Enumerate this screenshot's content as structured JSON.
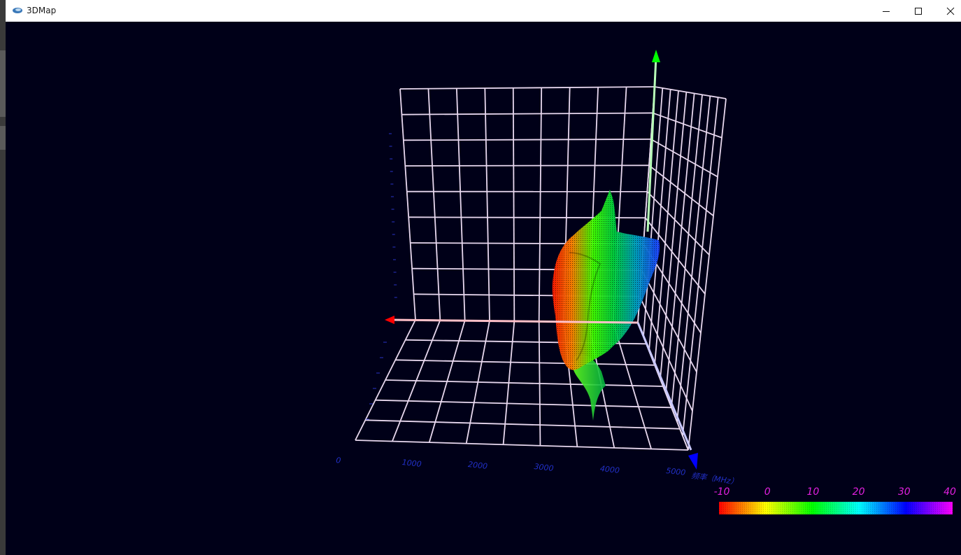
{
  "window": {
    "title": "3DMap",
    "icons": {
      "app": "map-app-icon",
      "minimize": "minimize-icon",
      "maximize": "maximize-icon",
      "close": "close-icon"
    }
  },
  "chart_data": {
    "type": "surface-3d",
    "x_axis": {
      "label": "频率（MHz）",
      "ticks": [
        "0",
        "1000",
        "2000",
        "3000",
        "4000",
        "5000"
      ],
      "range": [
        0,
        5000
      ]
    },
    "colorbar": {
      "ticks": [
        "-10",
        "0",
        "10",
        "20",
        "30",
        "40"
      ],
      "range": [
        -10,
        40
      ],
      "colors": [
        "#ff0000",
        "#ffff00",
        "#00ff00",
        "#00ffff",
        "#0000ff",
        "#ff00ff"
      ]
    },
    "axes_colors": {
      "x": "#ff0000",
      "y": "#00ff00",
      "z": "#0000ff"
    },
    "grid": true,
    "background": "#000018"
  }
}
